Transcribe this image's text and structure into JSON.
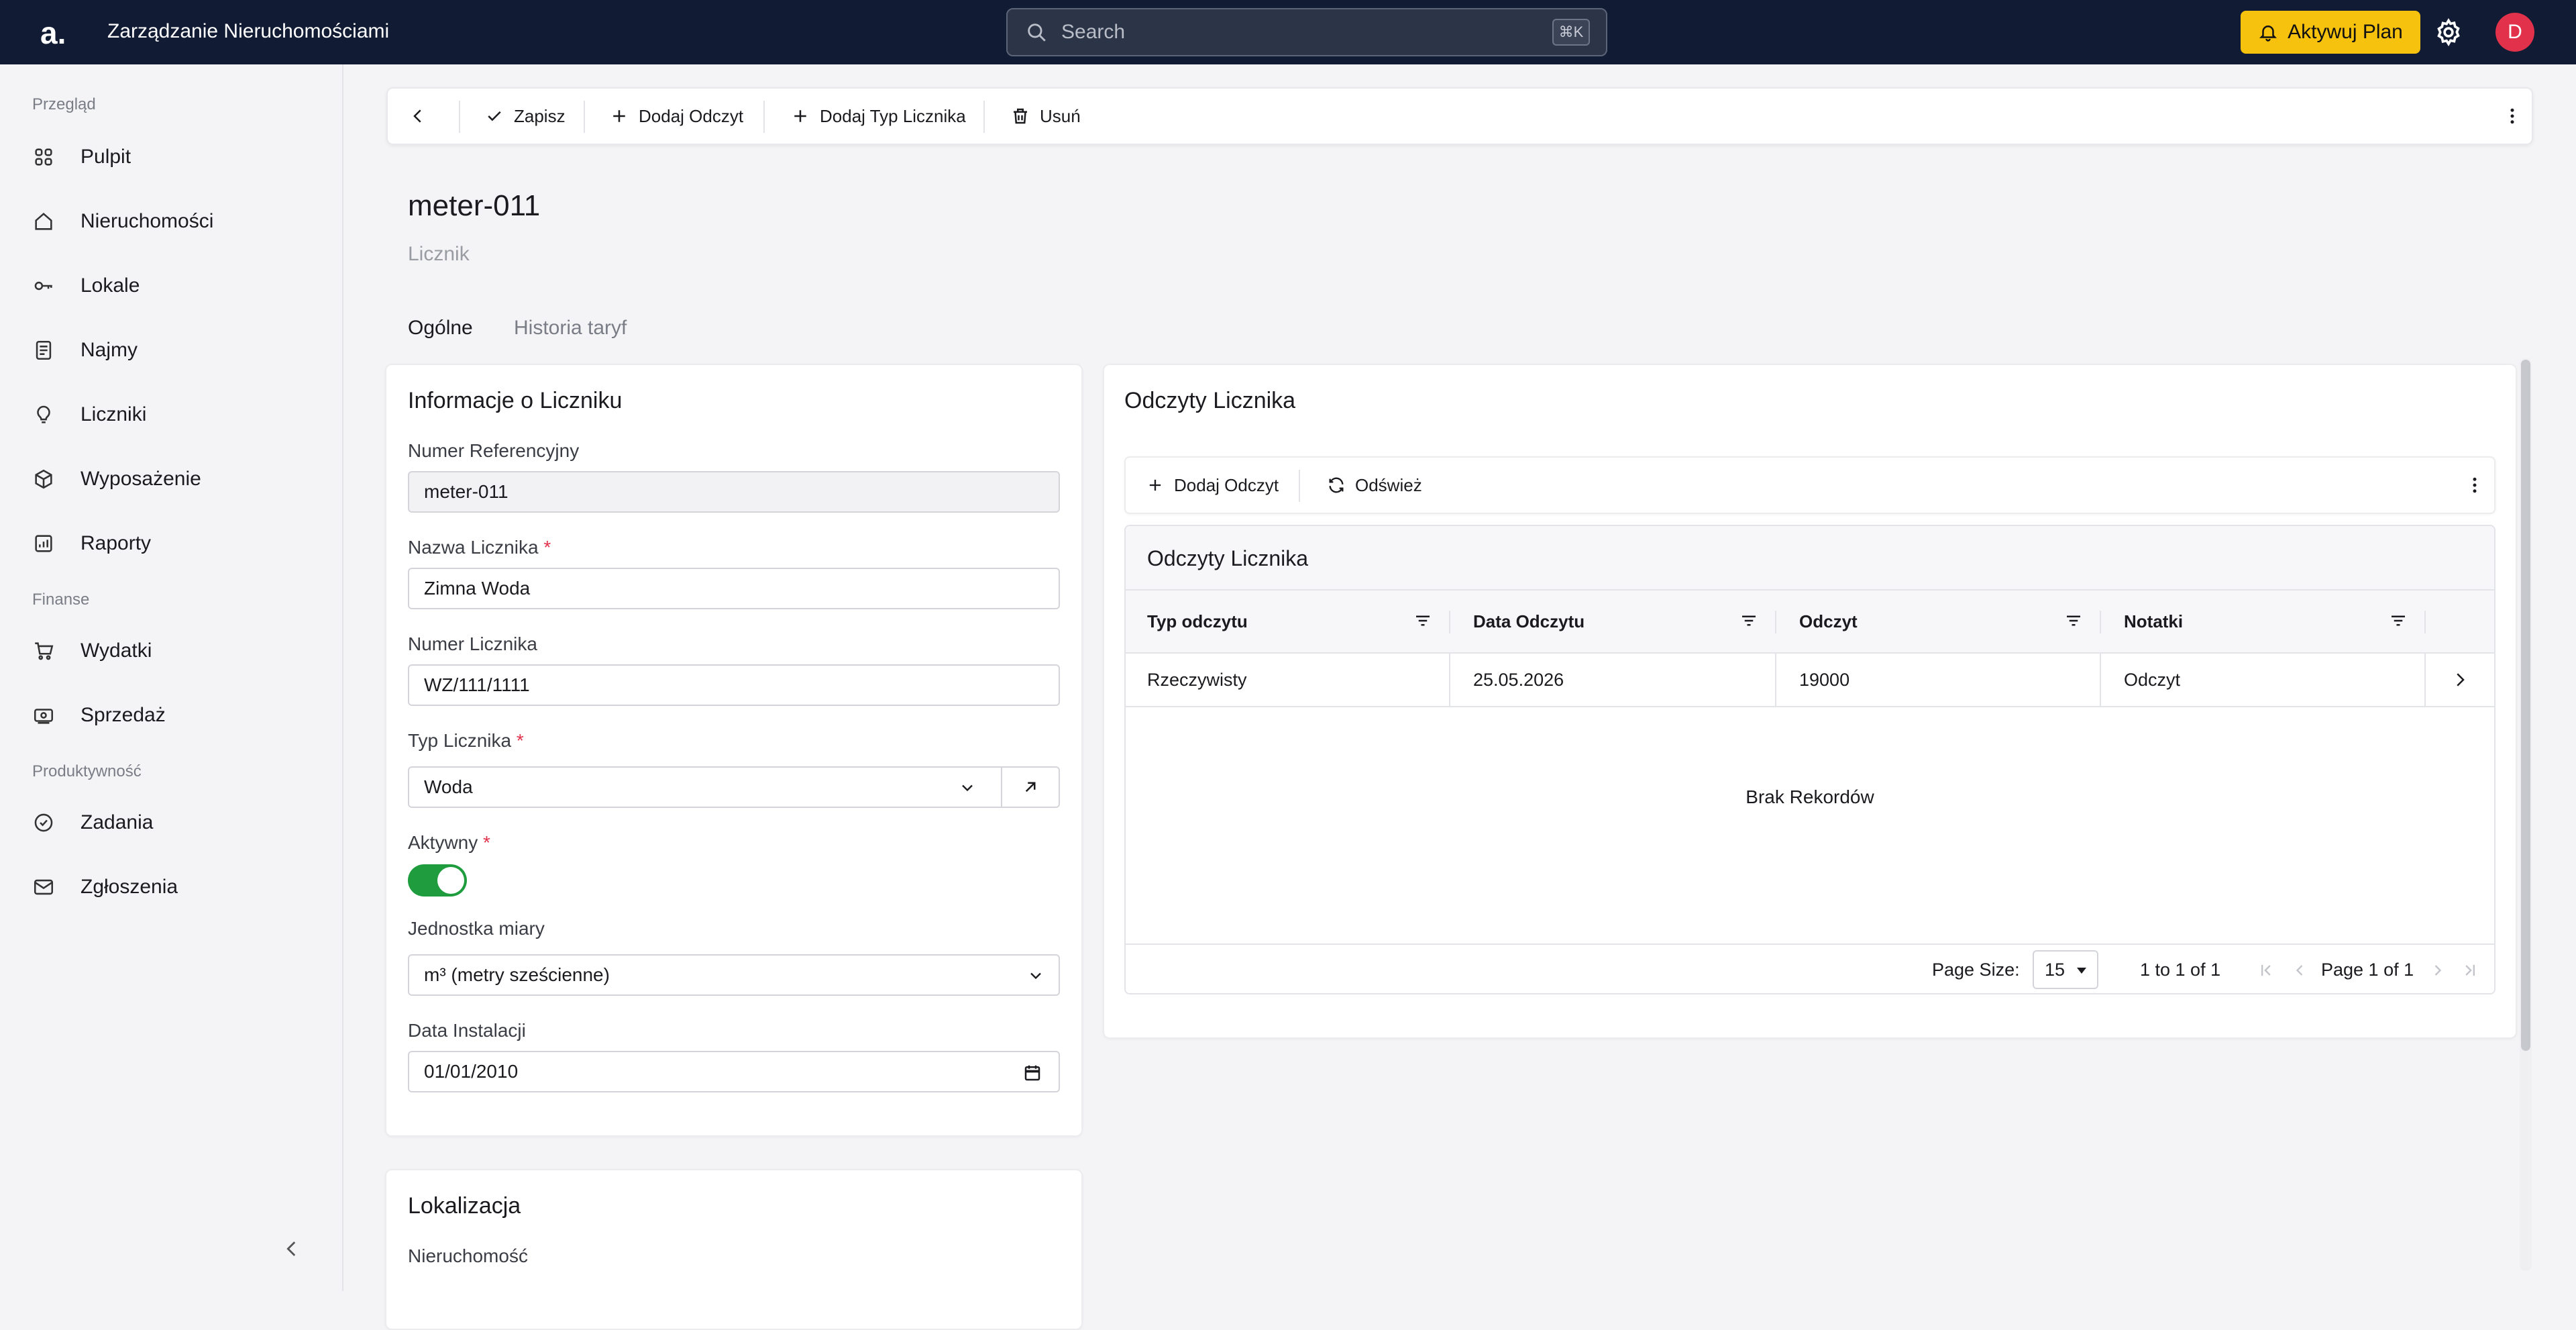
{
  "topbar": {
    "logo": "a.",
    "app_title": "Zarządzanie Nieruchomościami",
    "search_placeholder": "Search",
    "search_shortcut": "⌘K",
    "plan_button": "Aktywuj Plan",
    "avatar_initial": "D",
    "accent_color": "#f6c20d",
    "bg_color": "#111b33"
  },
  "sidebar": {
    "sections": [
      {
        "label": "Przegląd",
        "items": [
          {
            "label": "Pulpit",
            "icon": "dashboard-icon"
          },
          {
            "label": "Nieruchomości",
            "icon": "home-icon"
          },
          {
            "label": "Lokale",
            "icon": "key-icon"
          },
          {
            "label": "Najmy",
            "icon": "document-icon"
          },
          {
            "label": "Liczniki",
            "icon": "bulb-icon"
          },
          {
            "label": "Wyposażenie",
            "icon": "box-icon"
          },
          {
            "label": "Raporty",
            "icon": "report-icon"
          }
        ]
      },
      {
        "label": "Finanse",
        "items": [
          {
            "label": "Wydatki",
            "icon": "cart-icon"
          },
          {
            "label": "Sprzedaż",
            "icon": "money-icon"
          }
        ]
      },
      {
        "label": "Produktywność",
        "items": [
          {
            "label": "Zadania",
            "icon": "check-circle-icon"
          },
          {
            "label": "Zgłoszenia",
            "icon": "mail-icon"
          }
        ]
      }
    ]
  },
  "toolbar": {
    "save": "Zapisz",
    "add_reading": "Dodaj Odczyt",
    "add_meter_type": "Dodaj Typ Licznika",
    "delete": "Usuń"
  },
  "page": {
    "title": "meter-011",
    "subtitle": "Licznik",
    "tabs": [
      {
        "label": "Ogólne",
        "active": true
      },
      {
        "label": "Historia taryf",
        "active": false
      }
    ]
  },
  "info_card": {
    "title": "Informacje o Liczniku",
    "ref_label": "Numer Referencyjny",
    "ref_value": "meter-011",
    "name_label": "Nazwa Licznika",
    "name_value": "Zimna Woda",
    "number_label": "Numer Licznika",
    "number_value": "WZ/111/1111",
    "type_label": "Typ Licznika",
    "type_value": "Woda",
    "active_label": "Aktywny",
    "active_value": true,
    "unit_label": "Jednostka miary",
    "unit_value": "m³ (metry sześcienne)",
    "install_label": "Data Instalacji",
    "install_value": "01/01/2010",
    "required_mark": "*"
  },
  "location_card": {
    "title": "Lokalizacja",
    "property_label": "Nieruchomość"
  },
  "readings_card": {
    "title": "Odczyty Licznika",
    "add_reading": "Dodaj Odczyt",
    "refresh": "Odśwież",
    "grid_title": "Odczyty Licznika",
    "columns": [
      "Typ odczytu",
      "Data Odczytu",
      "Odczyt",
      "Notatki"
    ],
    "rows": [
      [
        "Rzeczywisty",
        "25.05.2026",
        "19000",
        "Odczyt"
      ]
    ],
    "empty_text": "Brak Rekordów",
    "page_size_label": "Page Size:",
    "page_size": "15",
    "range": "1 to 1 of 1",
    "page_info": "Page 1 of 1"
  }
}
